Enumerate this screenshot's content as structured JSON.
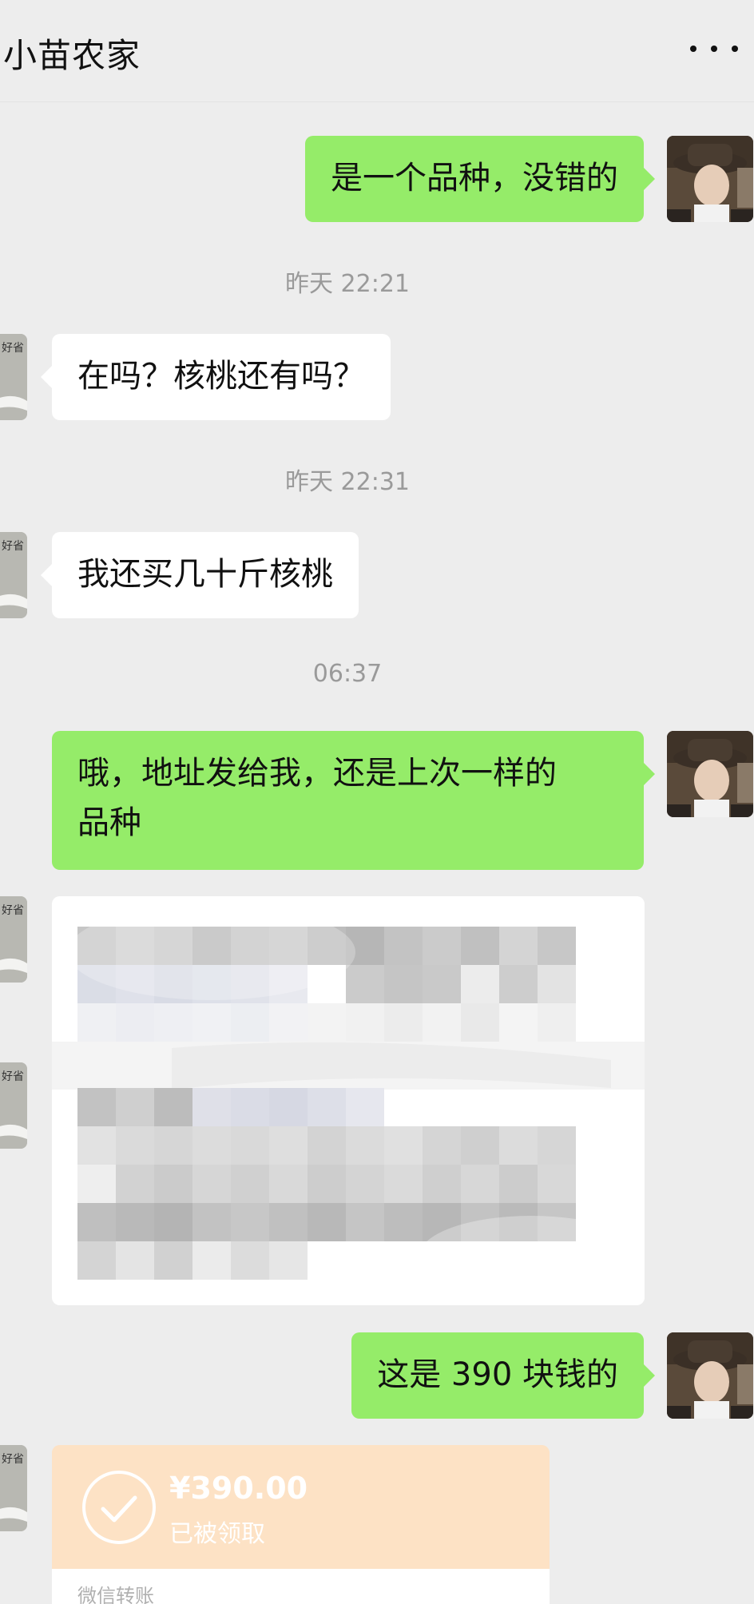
{
  "header": {
    "title": "小苗农家",
    "more_icon": "more-dots-icon"
  },
  "messages": [
    {
      "side": "right",
      "type": "text",
      "text": "是一个品种，没错的"
    },
    {
      "type": "time",
      "text": "昨天 22:21"
    },
    {
      "side": "left",
      "type": "text",
      "text": "在吗？核桃还有吗？"
    },
    {
      "type": "time",
      "text": "昨天 22:31"
    },
    {
      "side": "left",
      "type": "text",
      "text": "我还买几十斤核桃"
    },
    {
      "type": "time",
      "text": "06:37"
    },
    {
      "side": "right",
      "type": "text",
      "text": "哦，地址发给我，还是上次一样的品种",
      "lines": [
        "哦，地址发给我，还是上次一样的",
        "品种"
      ]
    },
    {
      "side": "left",
      "type": "redacted-card"
    },
    {
      "side": "right",
      "type": "text",
      "text": "这是 390 块钱的"
    },
    {
      "side": "left",
      "type": "transfer",
      "amount": "¥390.00",
      "status": "已被领取",
      "source": "微信转账"
    }
  ],
  "avatars": {
    "other_label": "好省"
  },
  "colors": {
    "background": "#ededed",
    "bubble_sent": "#95ec69",
    "bubble_received": "#ffffff",
    "transfer_received": "#fde2c5",
    "timestamp": "#9a9a9a"
  }
}
